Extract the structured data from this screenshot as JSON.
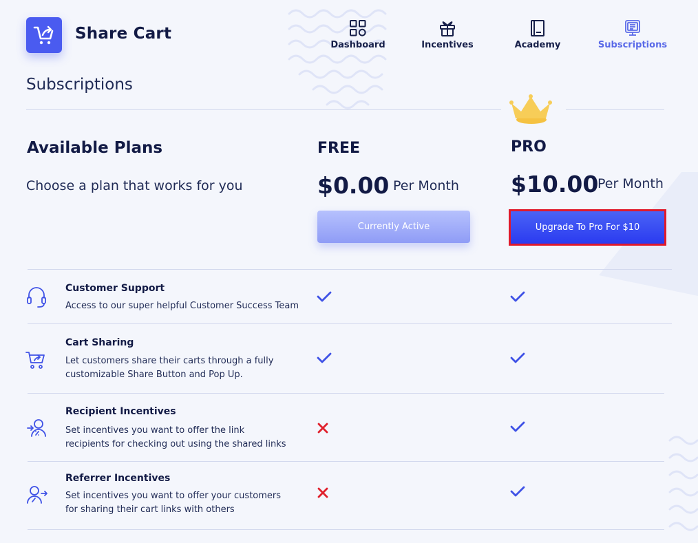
{
  "app": {
    "brand": "Share Cart"
  },
  "nav": [
    {
      "label": "Dashboard",
      "icon": "grid-icon",
      "active": false
    },
    {
      "label": "Incentives",
      "icon": "gift-icon",
      "active": false
    },
    {
      "label": "Academy",
      "icon": "book-icon",
      "active": false
    },
    {
      "label": "Subscriptions",
      "icon": "subscriptions-icon",
      "active": true
    }
  ],
  "page": {
    "title": "Subscriptions"
  },
  "plans_section": {
    "heading": "Available Plans",
    "subheading": "Choose a plan that works for you"
  },
  "plans": [
    {
      "name": "FREE",
      "price": "$0.00",
      "period": "Per Month",
      "button": "Currently Active"
    },
    {
      "name": "PRO",
      "price": "$10.00",
      "period": "Per Month",
      "button": "Upgrade To Pro For $10"
    }
  ],
  "features": [
    {
      "title": "Customer Support",
      "description": "Access to our super helpful Customer Success Team",
      "icon": "headset-icon",
      "free": "included",
      "pro": "included"
    },
    {
      "title": "Cart Sharing",
      "description": "Let customers share their carts through a fully customizable Share Button and Pop Up.",
      "icon": "cart-share-icon",
      "free": "included",
      "pro": "included"
    },
    {
      "title": "Recipient Incentives",
      "description": "Set incentives you want to offer the link recipients for checking out using the shared links",
      "icon": "recipient-user-icon",
      "free": "not-included",
      "pro": "included"
    },
    {
      "title": "Referrer Incentives",
      "description": "Set incentives you want to offer your customers for sharing their cart links with others",
      "icon": "referrer-user-icon",
      "free": "not-included",
      "pro": "included"
    }
  ],
  "colors": {
    "accent": "#4a5bf0",
    "upgrade_button": "#2b3bf0",
    "active_button": "#a3b0fa",
    "check": "#3f52e6",
    "cross": "#e0202c",
    "highlight_border": "#e01a2c",
    "crown": "#f7c94b"
  }
}
